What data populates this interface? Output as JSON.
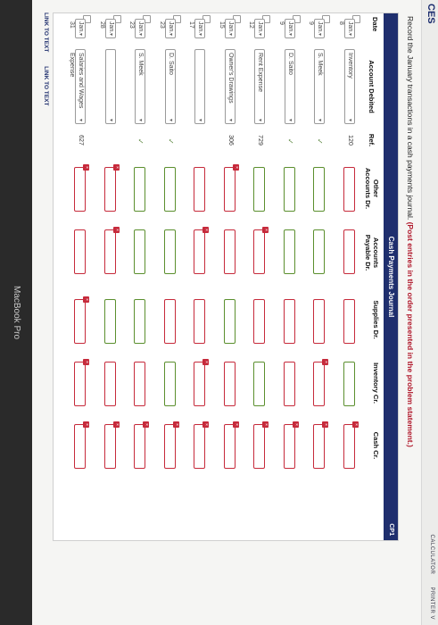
{
  "header": {
    "section": "CES",
    "calculator": "CALCULATOR",
    "printer": "PRINTER V"
  },
  "instruction": {
    "text": "Record the January transactions in a cash payments journal.",
    "emphasis": "(Post entries in the order presented in the problem statement.)"
  },
  "journal": {
    "title": "Cash Payments Journal",
    "code": "CP1",
    "columns": {
      "date": "Date",
      "account": "Account Debited",
      "ref": "Ref.",
      "other": "Other Accounts Dr.",
      "ap": "Accounts Payable Dr.",
      "supplies": "Supplies Dr.",
      "inventory": "Inventory Cr.",
      "cash": "Cash Cr."
    },
    "rows": [
      {
        "date": "Jan. 8",
        "account": "Inventory",
        "ref": "120",
        "checked": false
      },
      {
        "date": "Jan. 9",
        "account": "S. Meek",
        "ref": "",
        "checked": true
      },
      {
        "date": "Jan. 9",
        "account": "D. Saito",
        "ref": "",
        "checked": true
      },
      {
        "date": "Jan. 12",
        "account": "Rent Expense",
        "ref": "729",
        "checked": false
      },
      {
        "date": "Jan. 15",
        "account": "Owner's Drawings",
        "ref": "306",
        "checked": false
      },
      {
        "date": "Jan. 17",
        "account": "",
        "ref": "",
        "checked": false
      },
      {
        "date": "Jan. 23",
        "account": "D. Saito",
        "ref": "",
        "checked": true
      },
      {
        "date": "Jan. 23",
        "account": "S. Meek",
        "ref": "",
        "checked": true
      },
      {
        "date": "Jan. 28",
        "account": "",
        "ref": "",
        "checked": false
      },
      {
        "date": "Jan. 31",
        "account": "Salaries and Wages Expense",
        "ref": "627",
        "checked": false
      }
    ]
  },
  "links": {
    "first": "LINK TO TEXT",
    "second": "LINK TO TEXT"
  },
  "device": {
    "label": "MacBook Pro"
  },
  "colors": {
    "header_bg": "#1f2f6e",
    "correct": "#5b8f2e",
    "incorrect": "#c62a3b"
  }
}
